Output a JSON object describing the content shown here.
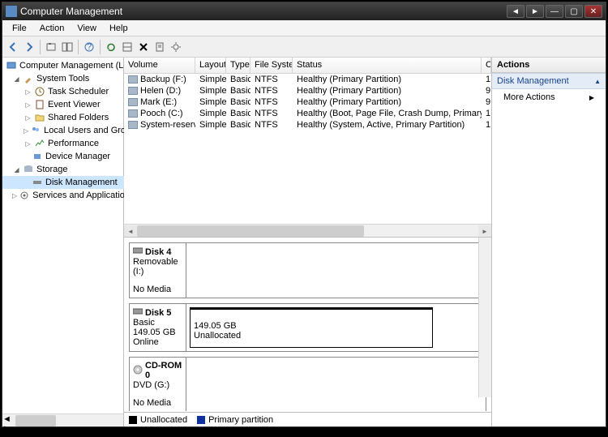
{
  "title": "Computer Management",
  "menu": {
    "file": "File",
    "action": "Action",
    "view": "View",
    "help": "Help"
  },
  "nav": {
    "root": "Computer Management (Local",
    "systools": "System Tools",
    "task": "Task Scheduler",
    "event": "Event Viewer",
    "shared": "Shared Folders",
    "users": "Local Users and Groups",
    "perf": "Performance",
    "devmgr": "Device Manager",
    "storage": "Storage",
    "diskmgmt": "Disk Management",
    "services": "Services and Applications"
  },
  "cols": {
    "volume": "Volume",
    "layout": "Layout",
    "type": "Type",
    "fs": "File System",
    "status": "Status",
    "c": "C"
  },
  "volumes": [
    {
      "name": "Backup (F:)",
      "layout": "Simple",
      "type": "Basic",
      "fs": "NTFS",
      "status": "Healthy (Primary Partition)",
      "c": "1"
    },
    {
      "name": "Helen (D:)",
      "layout": "Simple",
      "type": "Basic",
      "fs": "NTFS",
      "status": "Healthy (Primary Partition)",
      "c": "9"
    },
    {
      "name": "Mark (E:)",
      "layout": "Simple",
      "type": "Basic",
      "fs": "NTFS",
      "status": "Healthy (Primary Partition)",
      "c": "9"
    },
    {
      "name": "Pooch (C:)",
      "layout": "Simple",
      "type": "Basic",
      "fs": "NTFS",
      "status": "Healthy (Boot, Page File, Crash Dump, Primary Partition)",
      "c": "1"
    },
    {
      "name": "System-reserviert",
      "layout": "Simple",
      "type": "Basic",
      "fs": "NTFS",
      "status": "Healthy (System, Active, Primary Partition)",
      "c": "1"
    }
  ],
  "disks": {
    "d4": {
      "name": "Disk 4",
      "l1": "Removable (I:)",
      "l2": "No Media"
    },
    "d5": {
      "name": "Disk 5",
      "l1": "Basic",
      "l2": "149.05 GB",
      "l3": "Online",
      "p_size": "149.05 GB",
      "p_state": "Unallocated"
    },
    "cd": {
      "name": "CD-ROM 0",
      "l1": "DVD (G:)",
      "l2": "No Media"
    }
  },
  "legend": {
    "unalloc": "Unallocated",
    "primary": "Primary partition"
  },
  "actions": {
    "hdr": "Actions",
    "group": "Disk Management",
    "more": "More Actions"
  }
}
